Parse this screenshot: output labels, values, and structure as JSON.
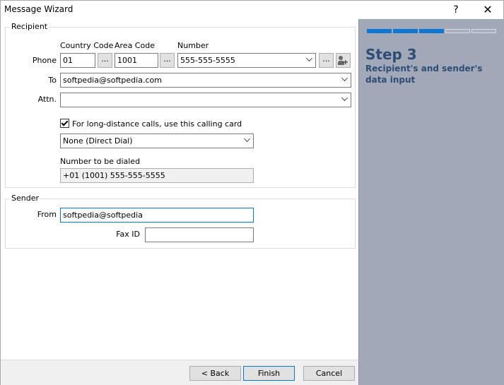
{
  "window": {
    "title": "Message Wizard",
    "help_label": "?",
    "close_label": "✕"
  },
  "recipient": {
    "group_title": "Recipient",
    "country_code_label": "Country Code",
    "area_code_label": "Area Code",
    "number_label": "Number",
    "phone_label": "Phone",
    "country_code_value": "01",
    "area_code_value": "1001",
    "number_value": "555-555-5555",
    "browse_label": "...",
    "to_label": "To",
    "to_value": "softpedia@softpedia.com",
    "attn_label": "Attn.",
    "attn_value": "",
    "calling_card_checkbox_label": "For long-distance calls, use this calling card",
    "calling_card_value": "None (Direct Dial)",
    "dialed_label": "Number to be dialed",
    "dialed_value": "+01 (1001) 555-555-5555"
  },
  "sender": {
    "group_title": "Sender",
    "from_label": "From",
    "from_value": "softpedia@softpedia",
    "fax_id_label": "Fax ID",
    "fax_id_value": ""
  },
  "buttons": {
    "back": "< Back",
    "finish": "Finish",
    "cancel": "Cancel"
  },
  "wizard": {
    "step_title": "Step 3",
    "step_subtitle": "Recipient's and sender's data input",
    "progress": {
      "completed_steps": 3,
      "total_steps": 5
    }
  },
  "colors": {
    "accent": "#0c78d4",
    "side_panel": "#a1a8b8",
    "step_text": "#2e4d75"
  }
}
